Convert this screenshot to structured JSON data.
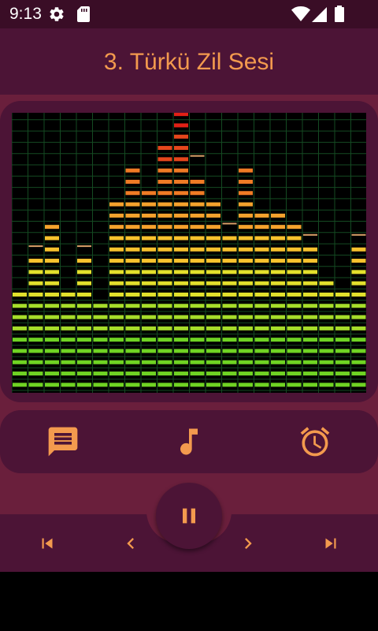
{
  "status_bar": {
    "time": "9:13",
    "icons": [
      "settings-gear-icon",
      "sd-card-icon",
      "wifi-icon",
      "signal-icon",
      "battery-icon"
    ]
  },
  "app": {
    "title": "3. Türkü Zil Sesi"
  },
  "equalizer": {
    "band_levels": [
      9,
      12,
      15,
      9,
      12,
      8,
      17,
      20,
      18,
      22,
      25,
      19,
      17,
      14,
      20,
      16,
      16,
      15,
      13,
      10,
      9,
      13
    ],
    "peak_levels": [
      9,
      13,
      15,
      9,
      13,
      8,
      17,
      20,
      18,
      22,
      25,
      21,
      17,
      15,
      20,
      16,
      16,
      15,
      14,
      10,
      9,
      14
    ],
    "segment_colors": [
      "#6fd323",
      "#a6dd2a",
      "#e2e02c",
      "#f7c22d",
      "#f5a22d",
      "#f07b25",
      "#e5471c",
      "#e02016"
    ],
    "peak_color": "#d9a068",
    "grid_color": "#144a22"
  },
  "controls": {
    "buttons": [
      "message-icon",
      "music-note-icon",
      "alarm-clock-icon"
    ],
    "accent": "#f39a4e"
  },
  "player": {
    "state": "playing",
    "buttons": [
      "skip-previous-icon",
      "chevron-left-icon",
      "pause-icon",
      "chevron-right-icon",
      "skip-next-icon"
    ]
  },
  "colors": {
    "background": "#6a1f3c",
    "panel": "#4c1436",
    "status_bar": "#3a0d26"
  }
}
